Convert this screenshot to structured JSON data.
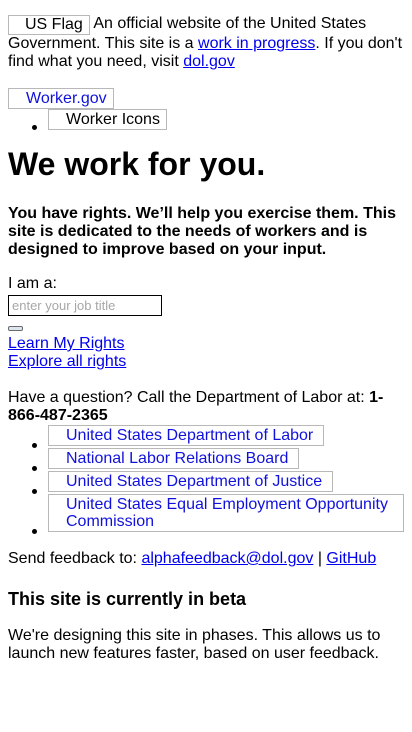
{
  "banner": {
    "flag_alt": "US Flag",
    "text_before": "An official website of the United States Government. This site is a",
    "wip_link": "work in progress",
    "text_middle": ". If you don't find what you need, visit",
    "dol_link": "dol.gov"
  },
  "brand": {
    "logo_alt": "Worker.gov"
  },
  "nav": {
    "items": [
      {
        "label": "Worker Icons"
      }
    ]
  },
  "hero": {
    "title": "We work for you.",
    "lede": "You have rights. We’ll help you exercise them. This site is dedicated to the needs of workers and is designed to improve based on your input."
  },
  "job_form": {
    "label": "I am a:",
    "placeholder": "enter your job title",
    "value": "",
    "learn_link": "Learn My Rights",
    "explore_link": "Explore all rights"
  },
  "question": {
    "text": "Have a question? Call the Department of Labor at:",
    "phone": "1-866-487-2365"
  },
  "agencies": [
    {
      "label": "United States Department of Labor"
    },
    {
      "label": "National Labor Relations Board"
    },
    {
      "label": "United States Department of Justice"
    },
    {
      "label": "United States Equal Employment Opportunity Commission"
    }
  ],
  "feedback": {
    "text": "Send feedback to:",
    "email": "alphafeedback@dol.gov",
    "separator": "|",
    "github": "GitHub"
  },
  "beta": {
    "title": "This site is currently in beta",
    "text": "We're designing this site in phases. This allows us to launch new features faster, based on user feedback."
  },
  "colors": {
    "link": "#0000ee",
    "image_alt_text": "#1111dd",
    "alt_border": "#b8b8b8"
  }
}
